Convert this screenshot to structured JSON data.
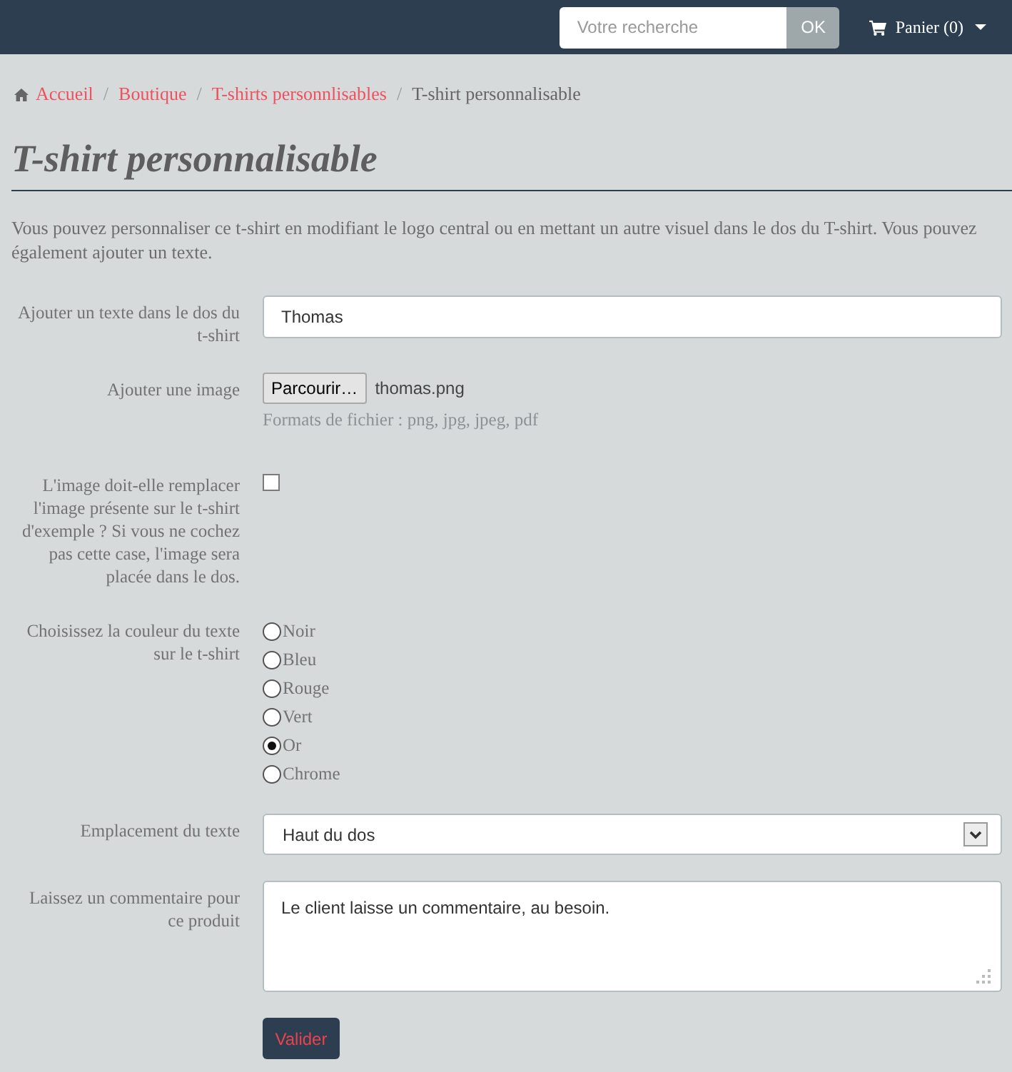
{
  "top_bar": {
    "search": {
      "placeholder": "Votre recherche",
      "button": "OK"
    },
    "cart": {
      "label": "Panier (0)"
    }
  },
  "breadcrumb": [
    {
      "kind": "home",
      "label": "Accueil"
    },
    {
      "kind": "separator",
      "label": "/"
    },
    {
      "kind": "link",
      "label": "Boutique"
    },
    {
      "kind": "separator",
      "label": "/"
    },
    {
      "kind": "link",
      "label": "T-shirts personnlisables"
    },
    {
      "kind": "separator",
      "label": "/"
    },
    {
      "kind": "current",
      "label": "T-shirt personnalisable"
    }
  ],
  "title": "T-shirt personnalisable",
  "intro": "Vous pouvez personnaliser ce t-shirt en modifiant le logo central ou en mettant un autre visuel dans le dos du T-shirt. Vous pouvez également ajouter un texte.",
  "form": {
    "fields": [
      {
        "kind": "text",
        "label": "Ajouter un texte dans le dos du t-shirt",
        "value": "Thomas"
      },
      {
        "kind": "file",
        "label": "Ajouter une image",
        "button": "Parcourir…",
        "filename": "thomas.png",
        "help": "Formats de fichier : png, jpg, jpeg, pdf"
      },
      {
        "kind": "checkbox",
        "label": "L'image doit-elle remplacer l'image présente sur le t-shirt d'exemple ? Si vous ne cochez pas cette case, l'image sera placée dans le dos.",
        "checked": false
      },
      {
        "kind": "radio",
        "label": "Choisissez la couleur du texte sur le t-shirt",
        "options": [
          {
            "label": "Noir",
            "selected": false
          },
          {
            "label": "Bleu",
            "selected": false
          },
          {
            "label": "Rouge",
            "selected": false
          },
          {
            "label": "Vert",
            "selected": false
          },
          {
            "label": "Or",
            "selected": true
          },
          {
            "label": "Chrome",
            "selected": false
          }
        ]
      },
      {
        "kind": "select",
        "label": "Emplacement du texte",
        "value": "Haut du dos"
      },
      {
        "kind": "textarea",
        "label": "Laissez un commentaire pour ce produit",
        "value": "Le client laisse un commentaire, au besoin."
      }
    ],
    "submit": "Valider"
  }
}
